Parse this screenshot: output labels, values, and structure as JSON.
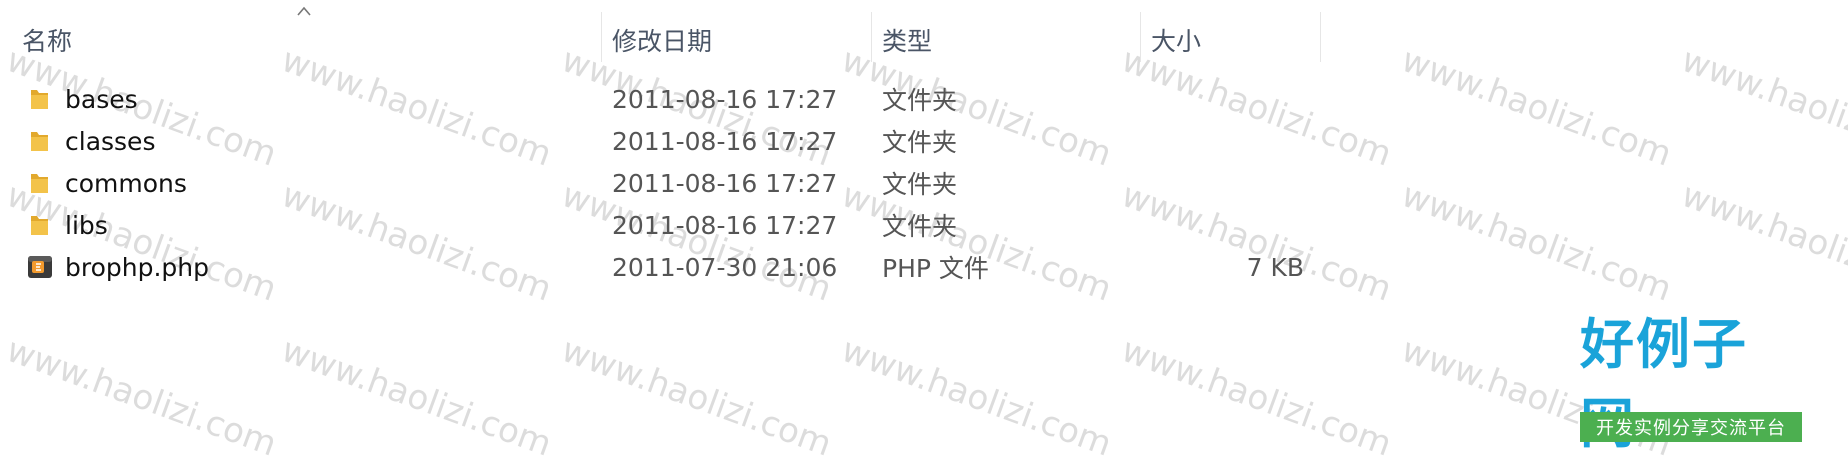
{
  "columns": {
    "name": "名称",
    "date": "修改日期",
    "type": "类型",
    "size": "大小"
  },
  "files": [
    {
      "name": "bases",
      "date": "2011-08-16 17:27",
      "type": "文件夹",
      "size": "",
      "icon": "folder-icon"
    },
    {
      "name": "classes",
      "date": "2011-08-16 17:27",
      "type": "文件夹",
      "size": "",
      "icon": "folder-icon"
    },
    {
      "name": "commons",
      "date": "2011-08-16 17:27",
      "type": "文件夹",
      "size": "",
      "icon": "folder-icon"
    },
    {
      "name": "libs",
      "date": "2011-08-16 17:27",
      "type": "文件夹",
      "size": "",
      "icon": "folder-icon"
    },
    {
      "name": "brophp.php",
      "date": "2011-07-30 21:06",
      "type": "PHP 文件",
      "size": "7 KB",
      "icon": "php-file-icon"
    }
  ],
  "watermark": "www.haolizi.com",
  "logo": {
    "title": "好例子网",
    "subtitle": "开发实例分享交流平台"
  },
  "colors": {
    "folder": "#f3c34a",
    "logo_blue": "#1aa3d9",
    "logo_green": "#4caf50",
    "header_text": "#4a5566"
  }
}
